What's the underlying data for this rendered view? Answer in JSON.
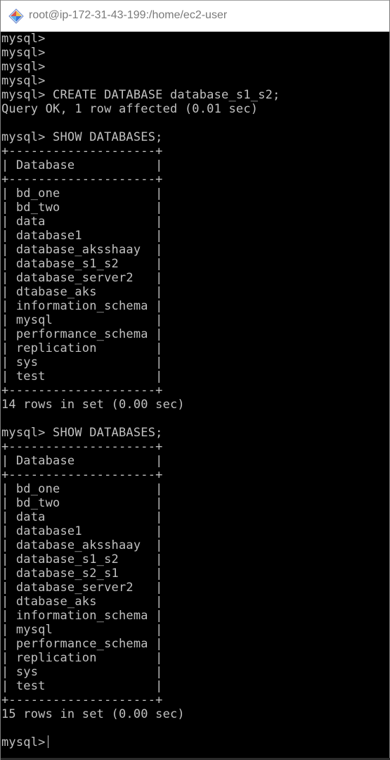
{
  "window": {
    "title": "root@ip-172-31-43-199:/home/ec2-user",
    "icon": "putty-terminal-icon"
  },
  "terminal": {
    "prompt": "mysql>",
    "lines": [
      "mysql>",
      "mysql>",
      "mysql>",
      "mysql>",
      "mysql> CREATE DATABASE database_s1_s2;",
      "Query OK, 1 row affected (0.01 sec)",
      "",
      "mysql> SHOW DATABASES;",
      "+--------------------+",
      "| Database           |",
      "+--------------------+",
      "| bd_one             |",
      "| bd_two             |",
      "| data               |",
      "| database1          |",
      "| database_aksshaay  |",
      "| database_s1_s2     |",
      "| database_server2   |",
      "| dtabase_aks        |",
      "| information_schema |",
      "| mysql              |",
      "| performance_schema |",
      "| replication        |",
      "| sys                |",
      "| test               |",
      "+--------------------+",
      "14 rows in set (0.00 sec)",
      "",
      "mysql> SHOW DATABASES;",
      "+--------------------+",
      "| Database           |",
      "+--------------------+",
      "| bd_one             |",
      "| bd_two             |",
      "| data               |",
      "| database1          |",
      "| database_aksshaay  |",
      "| database_s1_s2     |",
      "| database_s2_s1     |",
      "| database_server2   |",
      "| dtabase_aks        |",
      "| information_schema |",
      "| mysql              |",
      "| performance_schema |",
      "| replication        |",
      "| sys                |",
      "| test               |",
      "+--------------------+",
      "15 rows in set (0.00 sec)",
      ""
    ],
    "colors": {
      "background": "#000000",
      "foreground": "#c0c0c0"
    }
  }
}
